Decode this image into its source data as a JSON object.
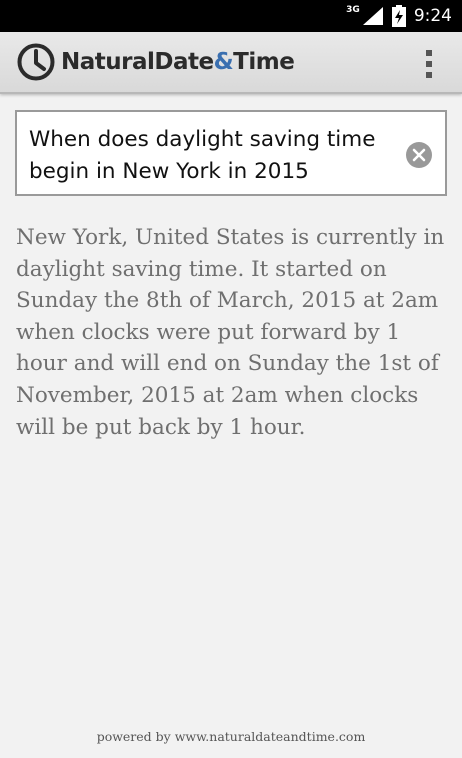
{
  "status_bar": {
    "network_label": "3G",
    "signal_icon": "signal-bars-icon",
    "battery_icon": "battery-charging-icon",
    "time": "9:24"
  },
  "app_bar": {
    "logo_icon": "clock-icon",
    "title_part1": "NaturalDate",
    "title_amp": "&",
    "title_part2": "Time",
    "menu_icon": "overflow-menu-icon"
  },
  "search": {
    "query": "When does daylight saving time begin in New York in 2015",
    "clear_icon": "clear-icon"
  },
  "result": {
    "answer": "New York, United States is currently in daylight saving time. It started on Sunday the 8th of March, 2015 at 2am when clocks were put forward by 1 hour and will end on Sunday the 1st of November, 2015 at 2am when clocks will be put back by 1 hour."
  },
  "footer": {
    "text": "powered by www.naturaldateandtime.com"
  },
  "colors": {
    "status_bar": "#000000",
    "app_bar": "#e0e0e0",
    "accent_amp": "#3a6fb0",
    "background": "#f2f2f2",
    "answer_text": "#6f6f6f"
  }
}
